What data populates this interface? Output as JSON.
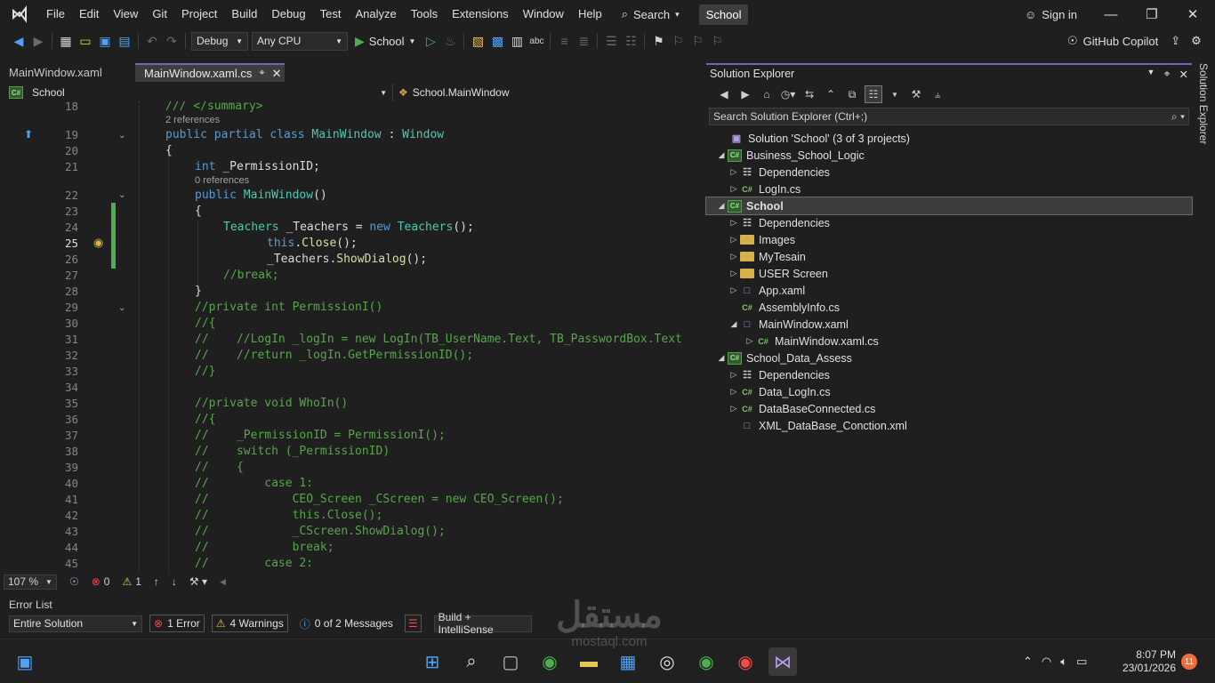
{
  "menu": [
    "File",
    "Edit",
    "View",
    "Git",
    "Project",
    "Build",
    "Debug",
    "Test",
    "Analyze",
    "Tools",
    "Extensions",
    "Window",
    "Help"
  ],
  "search_label": "Search",
  "solution_name": "School",
  "sign_in": "Sign in",
  "toolbar": {
    "config": "Debug",
    "platform": "Any CPU",
    "run_target": "School",
    "copilot": "GitHub Copilot"
  },
  "tabs": [
    {
      "label": "MainWindow.xaml"
    },
    {
      "label": "MainWindow.xaml.cs"
    }
  ],
  "nav": {
    "project": "School",
    "member": "School.MainWindow"
  },
  "code_lines": [
    {
      "n": "18",
      "lens": ""
    },
    {
      "n": "19",
      "lens": "2 references"
    },
    {
      "n": "20",
      "lens": ""
    },
    {
      "n": "21",
      "lens": ""
    },
    {
      "n": "22",
      "lens": "0 references"
    },
    {
      "n": "23",
      "lens": ""
    },
    {
      "n": "24",
      "lens": ""
    },
    {
      "n": "25",
      "lens": ""
    },
    {
      "n": "26",
      "lens": ""
    },
    {
      "n": "27",
      "lens": ""
    },
    {
      "n": "28",
      "lens": ""
    },
    {
      "n": "29",
      "lens": ""
    },
    {
      "n": "30",
      "lens": ""
    },
    {
      "n": "31",
      "lens": ""
    },
    {
      "n": "32",
      "lens": ""
    },
    {
      "n": "33",
      "lens": ""
    },
    {
      "n": "34",
      "lens": ""
    },
    {
      "n": "35",
      "lens": ""
    },
    {
      "n": "36",
      "lens": ""
    },
    {
      "n": "37",
      "lens": ""
    },
    {
      "n": "38",
      "lens": ""
    },
    {
      "n": "39",
      "lens": ""
    },
    {
      "n": "40",
      "lens": ""
    },
    {
      "n": "41",
      "lens": ""
    },
    {
      "n": "42",
      "lens": ""
    },
    {
      "n": "43",
      "lens": ""
    },
    {
      "n": "44",
      "lens": ""
    },
    {
      "n": "45",
      "lens": ""
    }
  ],
  "code_text": {
    "l18": "/// </summary>",
    "l19a": "public partial class ",
    "l19b": "MainWindow",
    "l19c": " : ",
    "l19d": "Window",
    "l20": "{",
    "l21a": "int",
    "l21b": " _PermissionID;",
    "l22a": "public ",
    "l22b": "MainWindow",
    "l22c": "()",
    "l23": "{",
    "l24a": "Teachers",
    "l24b": " _Teachers = ",
    "l24c": "new ",
    "l24d": "Teachers",
    "l24e": "();",
    "l25a": "this",
    "l25b": ".",
    "l25c": "Close",
    "l25d": "();",
    "l26a": "_Teachers.",
    "l26b": "ShowDialog",
    "l26c": "();",
    "l27": "//break;",
    "l28": "}",
    "l29": "//private int PermissionI()",
    "l30": "//{",
    "l31": "//    //LogIn _logIn = new LogIn(TB_UserName.Text, TB_PasswordBox.Text",
    "l32": "//    //return _logIn.GetPermissionID();",
    "l33": "//}",
    "l34": "",
    "l35": "//private void WhoIn()",
    "l36": "//{",
    "l37": "//    _PermissionID = PermissionI();",
    "l38": "//    switch (_PermissionID)",
    "l39": "//    {",
    "l40": "//        case 1:",
    "l41": "//            CEO_Screen _CScreen = new CEO_Screen();",
    "l42": "//            this.Close();",
    "l43": "//            _CScreen.ShowDialog();",
    "l44": "//            break;",
    "l45": "//        case 2:"
  },
  "editor_status": {
    "zoom": "107 %",
    "errors": "0",
    "warnings": "1"
  },
  "error_list": {
    "title": "Error List",
    "scope": "Entire Solution",
    "errors": "1 Error",
    "warnings": "4 Warnings",
    "messages": "0 of 2 Messages",
    "source": "Build + IntelliSense"
  },
  "solution_explorer": {
    "title": "Solution Explorer",
    "search_placeholder": "Search Solution Explorer (Ctrl+;)",
    "vertical_tab": "Solution Explorer",
    "items": [
      {
        "label": "Solution 'School' (3 of 3 projects)",
        "icon": "solution-icon",
        "expander": ""
      },
      {
        "label": "Business_School_Logic",
        "icon": "csharp-project-icon",
        "expander": "expanded"
      },
      {
        "label": "Dependencies",
        "icon": "dependencies-icon",
        "expander": "collapsed"
      },
      {
        "label": "LogIn.cs",
        "icon": "csharp-file-icon",
        "expander": "collapsed"
      },
      {
        "label": "School",
        "icon": "csharp-project-icon",
        "expander": "expanded"
      },
      {
        "label": "Dependencies",
        "icon": "dependencies-icon",
        "expander": "collapsed"
      },
      {
        "label": "Images",
        "icon": "folder-icon",
        "expander": "collapsed"
      },
      {
        "label": "MyTesain",
        "icon": "folder-icon",
        "expander": "collapsed"
      },
      {
        "label": "USER Screen",
        "icon": "folder-icon",
        "expander": "collapsed"
      },
      {
        "label": "App.xaml",
        "icon": "xaml-file-icon",
        "expander": "collapsed"
      },
      {
        "label": "AssemblyInfo.cs",
        "icon": "csharp-file-icon",
        "expander": ""
      },
      {
        "label": "MainWindow.xaml",
        "icon": "xaml-file-icon",
        "expander": "expanded"
      },
      {
        "label": "MainWindow.xaml.cs",
        "icon": "csharp-file-icon",
        "expander": "collapsed"
      },
      {
        "label": "School_Data_Assess",
        "icon": "csharp-project-icon",
        "expander": "expanded"
      },
      {
        "label": "Dependencies",
        "icon": "dependencies-icon",
        "expander": "collapsed"
      },
      {
        "label": "Data_LogIn.cs",
        "icon": "csharp-file-icon",
        "expander": "collapsed"
      },
      {
        "label": "DataBaseConnected.cs",
        "icon": "csharp-file-icon",
        "expander": "collapsed"
      },
      {
        "label": "XML_DataBase_Conction.xml",
        "icon": "xml-file-icon",
        "expander": ""
      }
    ]
  },
  "taskbar": {
    "time": "8:07 PM",
    "date": "23/01/2026",
    "notifications": "11"
  },
  "watermark": {
    "arabic": "مستقل",
    "latin": "mostaql.com"
  }
}
